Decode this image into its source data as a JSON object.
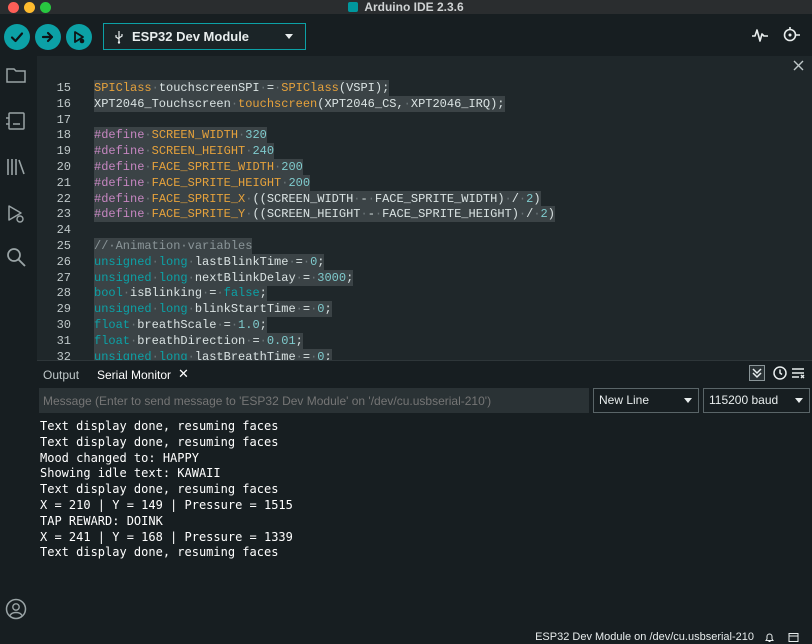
{
  "window": {
    "title": "Arduino IDE 2.3.6"
  },
  "toolbar": {
    "verify_icon": "check-icon",
    "upload_icon": "arrow-right-icon",
    "debug_icon": "debug-icon",
    "board_name": "ESP32 Dev Module",
    "board_icon": "usb-icon",
    "plotter_icon": "serial-plotter-icon",
    "monitor_icon": "serial-monitor-icon"
  },
  "sidebar": {
    "items": [
      "folder-icon",
      "boards-manager-icon",
      "library-icon",
      "debug-icon",
      "search-icon"
    ],
    "account_icon": "account-icon"
  },
  "editor": {
    "lines": [
      {
        "n": "15",
        "code": "SPIClass·touchscreenSPI·=·SPIClass(VSPI);"
      },
      {
        "n": "16",
        "code": "XPT2046_Touchscreen·touchscreen(XPT2046_CS,·XPT2046_IRQ);"
      },
      {
        "n": "17",
        "code": ""
      },
      {
        "n": "18",
        "code": "#define·SCREEN_WIDTH·320"
      },
      {
        "n": "19",
        "code": "#define·SCREEN_HEIGHT·240"
      },
      {
        "n": "20",
        "code": "#define·FACE_SPRITE_WIDTH·200"
      },
      {
        "n": "21",
        "code": "#define·FACE_SPRITE_HEIGHT·200"
      },
      {
        "n": "22",
        "code": "#define·FACE_SPRITE_X·((SCREEN_WIDTH·-·FACE_SPRITE_WIDTH)·/·2)"
      },
      {
        "n": "23",
        "code": "#define·FACE_SPRITE_Y·((SCREEN_HEIGHT·-·FACE_SPRITE_HEIGHT)·/·2)"
      },
      {
        "n": "24",
        "code": ""
      },
      {
        "n": "25",
        "code": "//·Animation·variables"
      },
      {
        "n": "26",
        "code": "unsigned·long·lastBlinkTime·=·0;"
      },
      {
        "n": "27",
        "code": "unsigned·long·nextBlinkDelay·=·3000;"
      },
      {
        "n": "28",
        "code": "bool·isBlinking·=·false;"
      },
      {
        "n": "29",
        "code": "unsigned·long·blinkStartTime·=·0;"
      },
      {
        "n": "30",
        "code": "float·breathScale·=·1.0;"
      },
      {
        "n": "31",
        "code": "float·breathDirection·=·0.01;"
      },
      {
        "n": "32",
        "code": "unsigned·long·lastBreathTime·=·0;"
      }
    ]
  },
  "panel": {
    "tab_output": "Output",
    "tab_serial": "Serial Monitor",
    "tab_close": "✕",
    "message_placeholder": "Message (Enter to send message to 'ESP32 Dev Module' on '/dev/cu.usbserial-210')",
    "line_ending": "New Line",
    "baud": "115200 baud",
    "serial_lines": [
      "Text display done, resuming faces",
      "Text display done, resuming faces",
      "Mood changed to: HAPPY",
      "Showing idle text: KAWAII",
      "Text display done, resuming faces",
      "X = 210 | Y = 149 | Pressure = 1515",
      "TAP REWARD: DOINK",
      "X = 241 | Y = 168 | Pressure = 1339",
      "Text display done, resuming faces"
    ]
  },
  "status": {
    "board_port": "ESP32 Dev Module on /dev/cu.usbserial-210"
  },
  "colors": {
    "accent": "#0ca1a6",
    "background": "#171e21",
    "editor_bg": "#1f272a"
  }
}
